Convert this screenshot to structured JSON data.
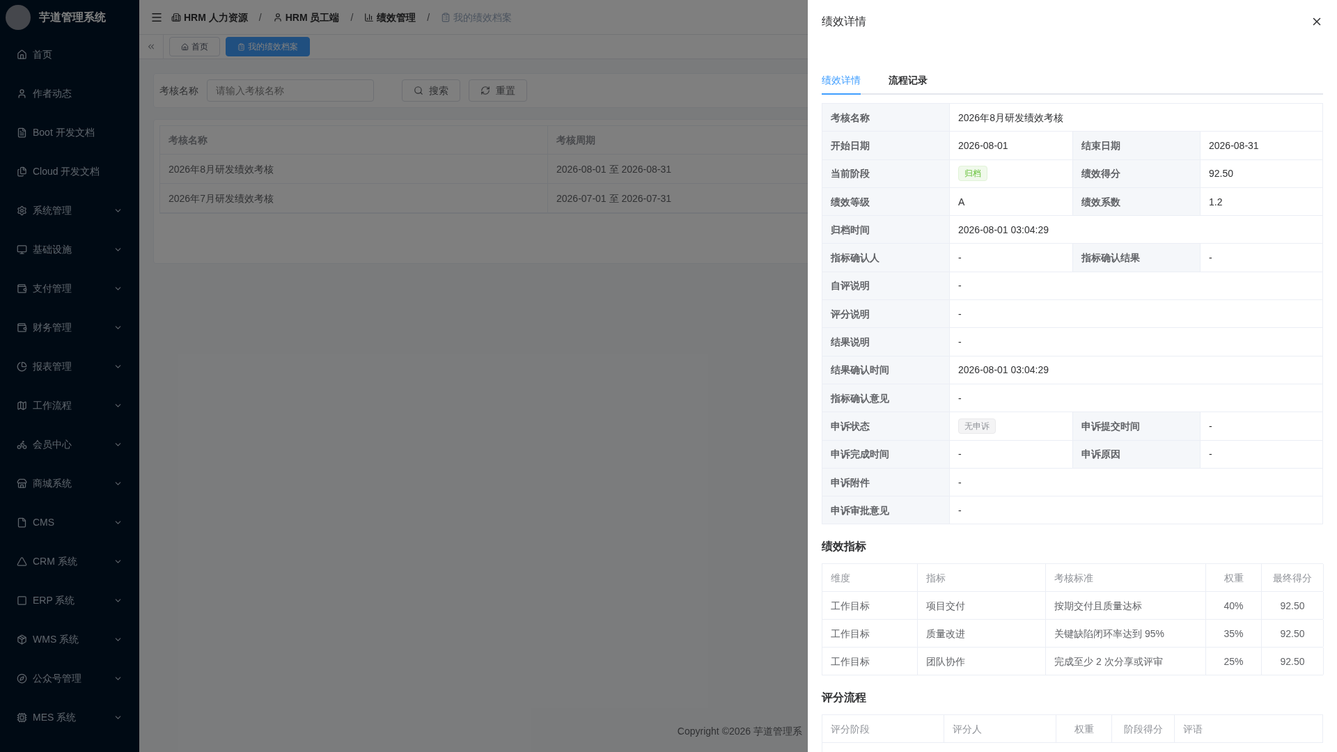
{
  "sidebar": {
    "logo_text": "芋道管理系统",
    "items": [
      {
        "label": "首页",
        "has_children": false
      },
      {
        "label": "作者动态",
        "has_children": false
      },
      {
        "label": "Boot 开发文档",
        "has_children": false
      },
      {
        "label": "Cloud 开发文档",
        "has_children": false
      },
      {
        "label": "系统管理",
        "has_children": true
      },
      {
        "label": "基础设施",
        "has_children": true
      },
      {
        "label": "支付管理",
        "has_children": true
      },
      {
        "label": "财务管理",
        "has_children": true
      },
      {
        "label": "报表管理",
        "has_children": true
      },
      {
        "label": "工作流程",
        "has_children": true
      },
      {
        "label": "会员中心",
        "has_children": true
      },
      {
        "label": "商城系统",
        "has_children": true
      },
      {
        "label": "CMS",
        "has_children": true
      },
      {
        "label": "CRM 系统",
        "has_children": true
      },
      {
        "label": "ERP 系统",
        "has_children": true
      },
      {
        "label": "WMS 系统",
        "has_children": true
      },
      {
        "label": "公众号管理",
        "has_children": true
      },
      {
        "label": "MES 系统",
        "has_children": true
      }
    ]
  },
  "breadcrumb_separator": "/",
  "breadcrumb": [
    {
      "label": "HRM 人力资源",
      "current": false
    },
    {
      "label": "HRM 员工端",
      "current": false
    },
    {
      "label": "绩效管理",
      "current": false
    },
    {
      "label": "我的绩效档案",
      "current": true
    }
  ],
  "tabs": [
    {
      "label": "首页",
      "selected": false
    },
    {
      "label": "我的绩效档案",
      "selected": true
    }
  ],
  "search": {
    "label": "考核名称",
    "placeholder": "请输入考核名称",
    "buttons": [
      "搜索",
      "重置"
    ]
  },
  "table": {
    "columns": [
      "考核名称",
      "考核周期"
    ],
    "rows": [
      [
        "2026年8月研发绩效考核",
        "2026-08-01 至 2026-08-31"
      ],
      [
        "2026年7月研发绩效考核",
        "2026-07-01 至 2026-07-31"
      ]
    ]
  },
  "footer": "Copyright ©2026 芋道管理系",
  "drawer": {
    "title": "绩效详情",
    "tabs": [
      {
        "label": "绩效详情",
        "selected": true
      },
      {
        "label": "流程记录",
        "selected": false
      }
    ],
    "details": [
      [
        {
          "label": "考核名称",
          "value": "2026年8月研发绩效考核"
        }
      ],
      [
        {
          "label": "开始日期",
          "value": "2026-08-01"
        },
        {
          "label": "结束日期",
          "value": "2026-08-31"
        }
      ],
      [
        {
          "label": "当前阶段",
          "tag": {
            "text": "归档",
            "kind": "success"
          }
        },
        {
          "label": "绩效得分",
          "value": "92.50"
        }
      ],
      [
        {
          "label": "绩效等级",
          "value": "A"
        },
        {
          "label": "绩效系数",
          "value": "1.2"
        }
      ],
      [
        {
          "label": "归档时间",
          "value": "2026-08-01 03:04:29"
        }
      ],
      [
        {
          "label": "指标确认人",
          "value": "-"
        },
        {
          "label": "指标确认结果",
          "value": "-"
        }
      ],
      [
        {
          "label": "自评说明",
          "value": "-"
        }
      ],
      [
        {
          "label": "评分说明",
          "value": "-"
        }
      ],
      [
        {
          "label": "结果说明",
          "value": "-"
        }
      ],
      [
        {
          "label": "结果确认时间",
          "value": "2026-08-01 03:04:29"
        }
      ],
      [
        {
          "label": "指标确认意见",
          "value": "-"
        }
      ],
      [
        {
          "label": "申诉状态",
          "tag": {
            "text": "无申诉",
            "kind": "info"
          }
        },
        {
          "label": "申诉提交时间",
          "value": "-"
        }
      ],
      [
        {
          "label": "申诉完成时间",
          "value": "-"
        },
        {
          "label": "申诉原因",
          "value": "-"
        }
      ],
      [
        {
          "label": "申诉附件",
          "value": "-"
        }
      ],
      [
        {
          "label": "申诉审批意见",
          "value": "-"
        }
      ]
    ],
    "indicators": {
      "title": "绩效指标",
      "columns": [
        "维度",
        "指标",
        "考核标准",
        "权重",
        "最终得分"
      ],
      "rows": [
        [
          "工作目标",
          "项目交付",
          "按期交付且质量达标",
          "40%",
          "92.50"
        ],
        [
          "工作目标",
          "质量改进",
          "关键缺陷闭环率达到 95%",
          "35%",
          "92.50"
        ],
        [
          "工作目标",
          "团队协作",
          "完成至少 2 次分享或评审",
          "25%",
          "92.50"
        ]
      ]
    },
    "scoring": {
      "title": "评分流程",
      "columns": [
        "评分阶段",
        "评分人",
        "权重",
        "阶段得分",
        "评语"
      ]
    }
  }
}
